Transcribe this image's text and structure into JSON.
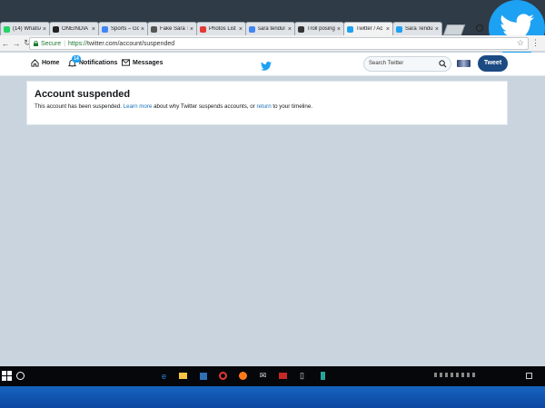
{
  "browser": {
    "tabs": [
      {
        "label": "(14) WhatsApp",
        "favicon_color": "#25d366",
        "active": false
      },
      {
        "label": "ONEINDIA",
        "favicon_color": "#222222",
        "active": false
      },
      {
        "label": "Sports – Go",
        "favicon_color": "#4285f4",
        "active": false
      },
      {
        "label": "Fake Sara Te",
        "favicon_color": "#555555",
        "active": false
      },
      {
        "label": "Photos List",
        "favicon_color": "#e53935",
        "active": false
      },
      {
        "label": "sara tendul",
        "favicon_color": "#4285f4",
        "active": false
      },
      {
        "label": "Troll posing",
        "favicon_color": "#333333",
        "active": false
      },
      {
        "label": "Twitter / Ac",
        "favicon_color": "#1da1f2",
        "active": true
      },
      {
        "label": "Sara Tendu",
        "favicon_color": "#1da1f2",
        "active": false
      }
    ],
    "tab_close_glyph": "×",
    "address": {
      "secure_label": "Secure",
      "url_protocol": "https://",
      "url_rest": "twitter.com/account/suspended"
    }
  },
  "twitter": {
    "nav": {
      "home_label": "Home",
      "notifications_label": "Notifications",
      "notifications_count": "14",
      "messages_label": "Messages"
    },
    "search": {
      "placeholder": "Search Twitter"
    },
    "tweet_button": "Tweet",
    "card": {
      "title": "Account suspended",
      "text_before": "This account has been suspended. ",
      "learn_more": "Learn more",
      "text_middle": " about why Twitter suspends accounts, or ",
      "return_link": "return",
      "text_after": " to your timeline."
    }
  },
  "colors": {
    "twitter_blue": "#1da1f2",
    "tweet_button": "#1b4b82",
    "page_background": "#c9d4de",
    "link": "#1b6fb5"
  }
}
